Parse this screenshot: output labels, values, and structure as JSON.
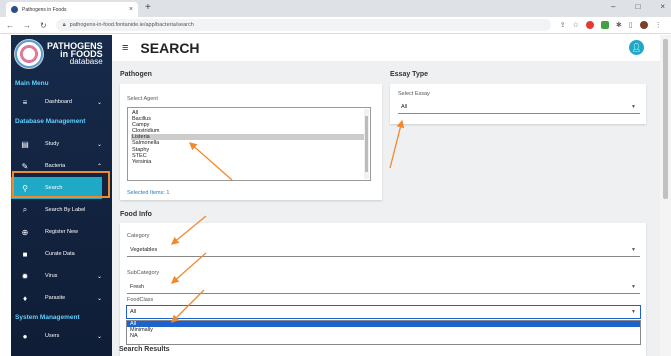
{
  "browser": {
    "tab_title": "Pathogens in Foods",
    "url": "pathogens-in-food.fontanide.ie/app/bacteria/search"
  },
  "logo": {
    "line1": "PATHOGENS",
    "line2": "in FOODS",
    "line3": "database"
  },
  "sidebar": {
    "main_menu": "Main Menu",
    "db_mgmt": "Database Management",
    "sys_mgmt": "System Management",
    "items": {
      "dashboard": "Dashboard",
      "study": "Study",
      "bacteria": "Bacteria",
      "search": "Search",
      "search_by_label": "Search By Label",
      "register_new": "Register New",
      "curate_data": "Curate Data",
      "virus": "Virus",
      "parasite": "Parasite",
      "users": "Users"
    }
  },
  "header": {
    "title": "SEARCH"
  },
  "pathogen": {
    "title": "Pathogen",
    "select_label": "Select Agent",
    "options": [
      "All",
      "Bacillus",
      "Campy",
      "Clostridium",
      "Listeria",
      "Salmonella",
      "Staphy",
      "STEC",
      "Yersinia"
    ],
    "selected": "Listeria",
    "selected_items": "Selected Items: 1"
  },
  "essay": {
    "title": "Essay Type",
    "select_label": "Select Essay",
    "value": "All"
  },
  "food": {
    "title": "Food Info",
    "category_label": "Category",
    "category_value": "Vegetables",
    "subcategory_label": "SubCategory",
    "subcategory_value": "Fresh",
    "foodclass_label": "FoodClass",
    "foodclass_value": "All",
    "foodclass_options": [
      "All",
      "Minimally",
      "NA"
    ]
  },
  "results": {
    "title": "Search Results"
  },
  "colors": {
    "sidebar": "#162a4a",
    "accent": "#1fa9c7",
    "section": "#5fd0ff",
    "highlight_box": "#f28a2c",
    "annotation_arrow": "#f28a2c"
  }
}
